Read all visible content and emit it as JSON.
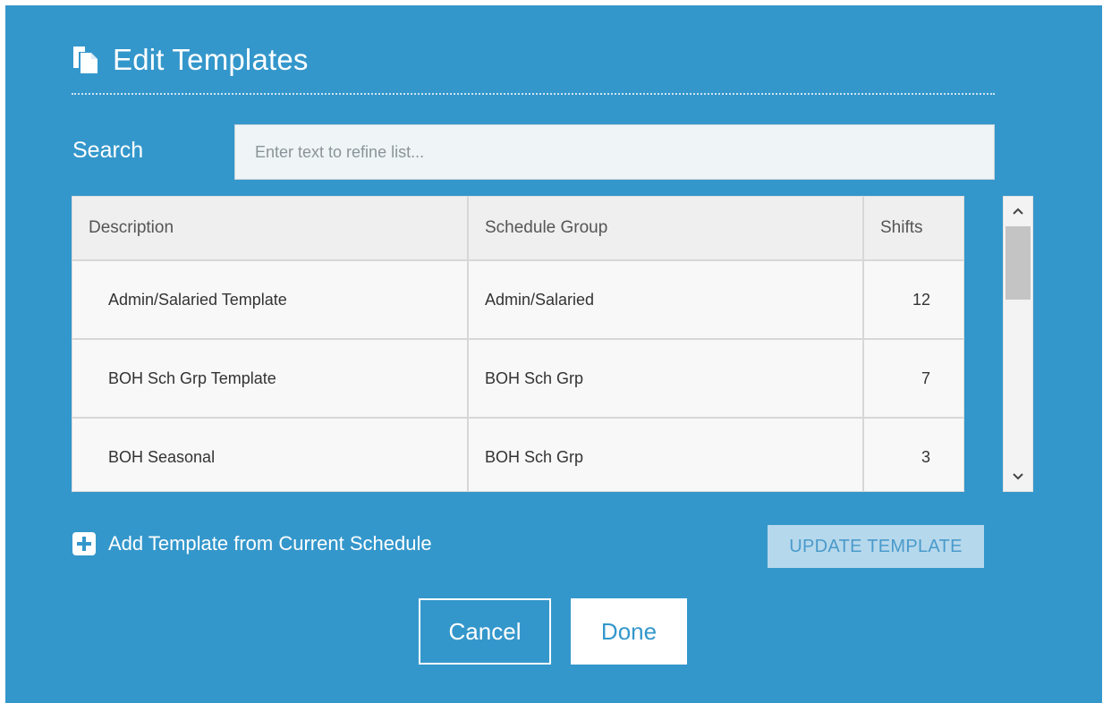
{
  "dialog": {
    "title": "Edit Templates",
    "title_icon": "copy-document-icon"
  },
  "search": {
    "label": "Search",
    "placeholder": "Enter text to refine list...",
    "value": ""
  },
  "table": {
    "columns": [
      "Description",
      "Schedule Group",
      "Shifts"
    ],
    "rows": [
      {
        "description": "Admin/Salaried Template",
        "group": "Admin/Salaried",
        "shifts": "12"
      },
      {
        "description": "BOH Sch Grp Template",
        "group": "BOH Sch Grp",
        "shifts": "7"
      },
      {
        "description": "BOH Seasonal",
        "group": "BOH Sch Grp",
        "shifts": "3"
      }
    ]
  },
  "scrollbar": {
    "up_glyph": "⌃",
    "down_glyph": "⌄"
  },
  "actions": {
    "add_template_label": "Add Template from Current Schedule",
    "add_icon": "plus-square-icon",
    "update_template_label": "UPDATE TEMPLATE",
    "cancel_label": "Cancel",
    "done_label": "Done"
  },
  "colors": {
    "dialog_background": "#3497cb",
    "update_button_background": "#b6d8ec",
    "done_button_text": "#3497cb"
  }
}
